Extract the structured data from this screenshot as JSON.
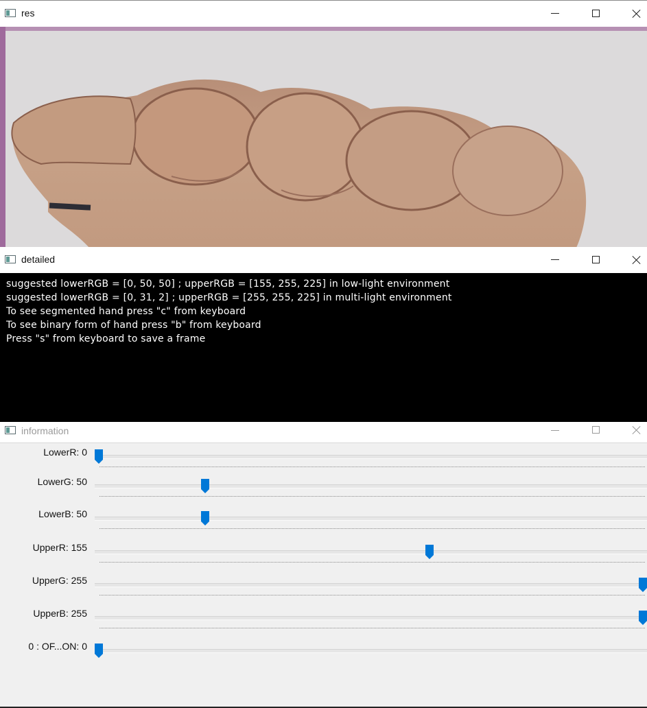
{
  "windows": {
    "res": {
      "title": "res"
    },
    "detailed": {
      "title": "detailed",
      "lines": [
        "suggested lowerRGB = [0, 50, 50] ; upperRGB = [155, 255, 225] in low-light environment",
        "suggested lowerRGB = [0, 31, 2] ; upperRGB = [255, 255, 225] in multi-light environment",
        "To see segmented hand press \"c\" from keyboard",
        "To see binary form of hand press \"b\" from keyboard",
        "Press \"s\" from keyboard to save a frame"
      ]
    },
    "information": {
      "title": "information",
      "trackbars": [
        {
          "name": "lower-r",
          "label": "LowerR: 0",
          "value": 0,
          "max": 255
        },
        {
          "name": "lower-g",
          "label": "LowerG: 50",
          "value": 50,
          "max": 255
        },
        {
          "name": "lower-b",
          "label": "LowerB: 50",
          "value": 50,
          "max": 255
        },
        {
          "name": "upper-r",
          "label": "UpperR: 155",
          "value": 155,
          "max": 255
        },
        {
          "name": "upper-g",
          "label": "UpperG: 255",
          "value": 255,
          "max": 255
        },
        {
          "name": "upper-b",
          "label": "UpperB: 255",
          "value": 255,
          "max": 255
        },
        {
          "name": "off-on",
          "label": "0 : OF...ON: 0",
          "value": 0,
          "max": 1
        }
      ]
    }
  },
  "icons": {
    "window": "app-window-icon",
    "minimize": "minimize-icon",
    "maximize": "maximize-icon",
    "close": "close-icon"
  },
  "colors": {
    "thumb": "#0078d7",
    "skin": "#c49a7e",
    "background": "#dcdadb"
  }
}
